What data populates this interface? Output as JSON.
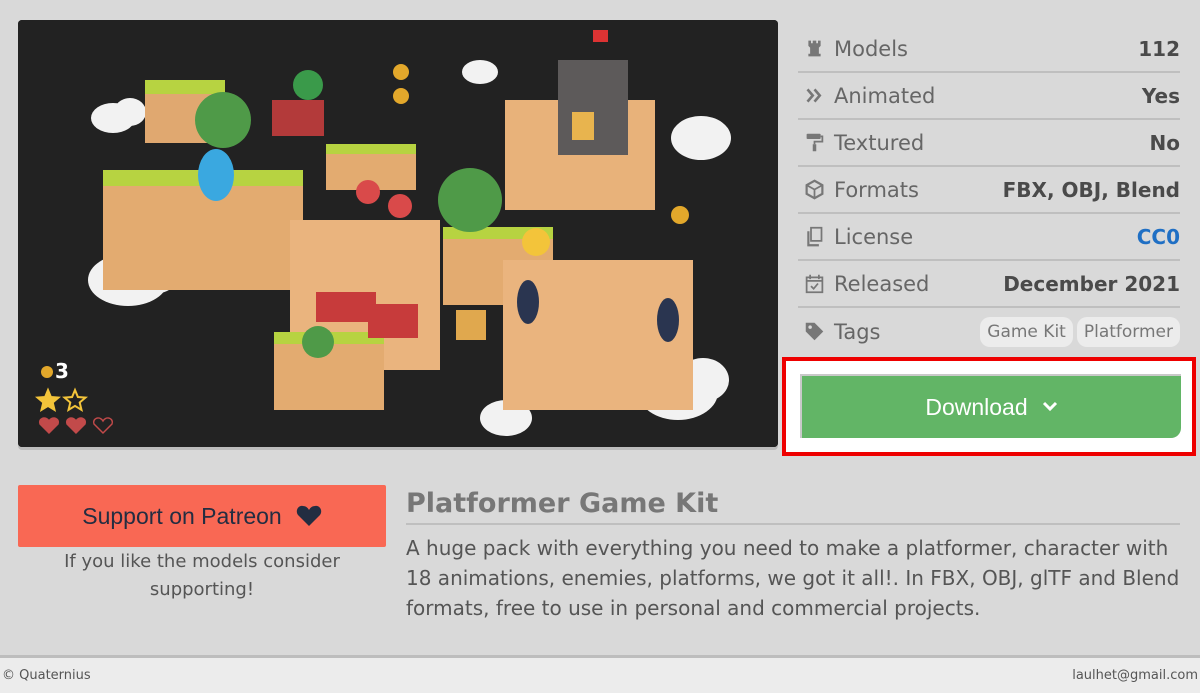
{
  "asset": {
    "title": "Platformer Game Kit",
    "description": "A huge pack with everything you need to make a platformer, character with 18 animations, enemies, platforms, we got it all!. In FBX, OBJ, glTF and Blend formats, free to use in personal and commercial projects."
  },
  "preview": {
    "hud_coins": "3",
    "stars_filled": 1,
    "stars_total": 2,
    "hearts_filled": 2,
    "hearts_total": 3
  },
  "info": {
    "models": {
      "label": "Models",
      "value": "112",
      "icon": "rook-icon"
    },
    "animated": {
      "label": "Animated",
      "value": "Yes",
      "icon": "double-chevron-icon"
    },
    "textured": {
      "label": "Textured",
      "value": "No",
      "icon": "paint-roller-icon"
    },
    "formats": {
      "label": "Formats",
      "value": "FBX, OBJ, Blend",
      "icon": "cube-icon"
    },
    "license": {
      "label": "License",
      "value": "CC0",
      "icon": "copy-icon"
    },
    "released": {
      "label": "Released",
      "value": "December 2021",
      "icon": "calendar-check-icon"
    },
    "tags": {
      "label": "Tags",
      "icon": "tag-icon",
      "items": [
        "Game Kit",
        "Platformer"
      ]
    }
  },
  "download": {
    "label": "Download",
    "icon": "chevron-down-icon",
    "highlight_color": "#e00000",
    "color": "#62b566"
  },
  "patreon": {
    "label": "Support on Patreon",
    "icon": "heart-icon",
    "note": "If you like the models consider supporting!",
    "color": "#f96854"
  },
  "footer": {
    "left": "© Quaternius",
    "right": "laulhet@gmail.com"
  }
}
